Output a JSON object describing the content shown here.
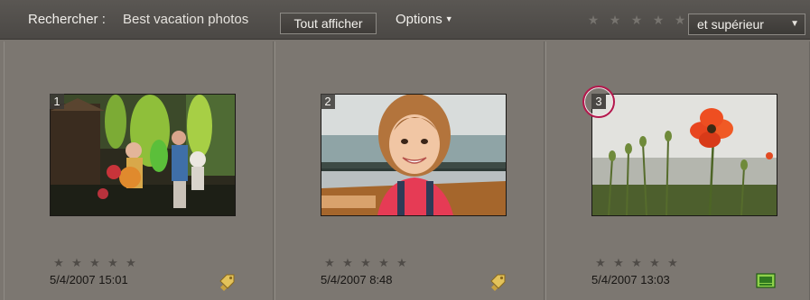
{
  "toolbar": {
    "search_label": "Rechercher :",
    "search_query": "Best vacation photos",
    "show_all_label": "Tout afficher",
    "options_label": "Options",
    "rating_filter_stars": [
      "★",
      "★",
      "★",
      "★",
      "★"
    ],
    "rating_select_value": "et supérieur"
  },
  "photos": [
    {
      "number": "1",
      "stars": [
        "★",
        "★",
        "★",
        "★",
        "★"
      ],
      "date": "5/4/2007 15:01",
      "badge_icon": "tag-icon",
      "highlighted": false
    },
    {
      "number": "2",
      "stars": [
        "★",
        "★",
        "★",
        "★",
        "★"
      ],
      "date": "5/4/2007 8:48",
      "badge_icon": "tag-icon",
      "highlighted": false
    },
    {
      "number": "3",
      "stars": [
        "★",
        "★",
        "★",
        "★",
        "★"
      ],
      "date": "5/4/2007 13:03",
      "badge_icon": "media-icon",
      "highlighted": true
    }
  ],
  "colors": {
    "toolbar_bg": "#4b4845",
    "grid_bg": "#7b7670",
    "highlight_ring": "#b4184d"
  }
}
